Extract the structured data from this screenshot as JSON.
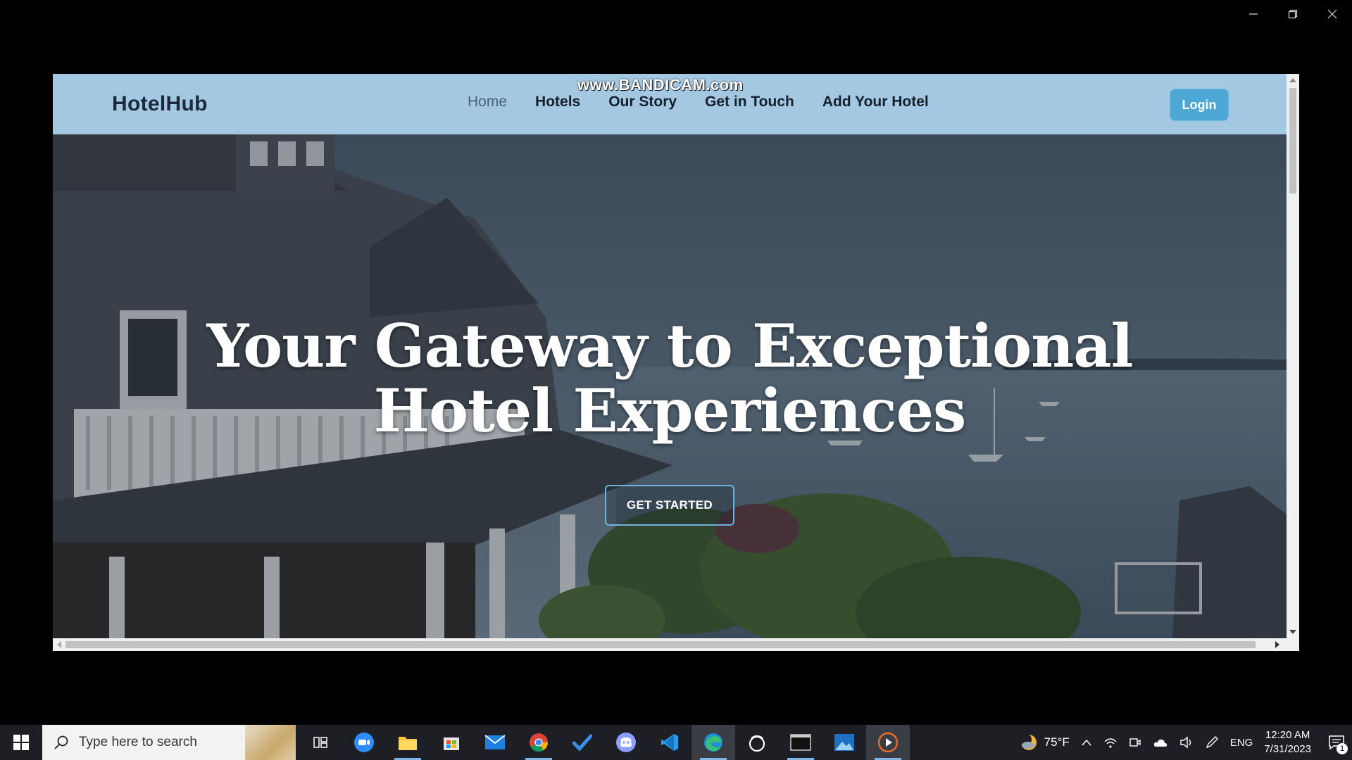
{
  "watermark": "www.BANDICAM.com",
  "navbar": {
    "brand": "HotelHub",
    "links": [
      {
        "label": "Home",
        "active": true
      },
      {
        "label": "Hotels"
      },
      {
        "label": "Our Story"
      },
      {
        "label": "Get in Touch"
      },
      {
        "label": "Add Your Hotel"
      }
    ],
    "login_label": "Login"
  },
  "hero": {
    "title_line1": "Your Gateway to Exceptional",
    "title_line2": "Hotel Experiences",
    "cta_label": "GET STARTED"
  },
  "taskbar": {
    "search_placeholder": "Type here to search",
    "apps": [
      "task-view-icon",
      "zoom-icon",
      "file-explorer-icon",
      "microsoft-store-icon",
      "mail-icon",
      "chrome-icon",
      "todo-icon",
      "discord-icon",
      "vscode-icon",
      "edge-icon",
      "obs-icon",
      "terminal-icon",
      "photos-icon",
      "media-player-icon"
    ],
    "weather": "75°F",
    "language": "ENG",
    "time": "12:20 AM",
    "date": "7/31/2023",
    "notification_count": "1"
  },
  "colors": {
    "navbar_bg": "#a5c8e2",
    "login_bg": "#4ea8d6",
    "cta_border": "#6fb4dc",
    "taskbar_bg": "#1d1f24"
  }
}
